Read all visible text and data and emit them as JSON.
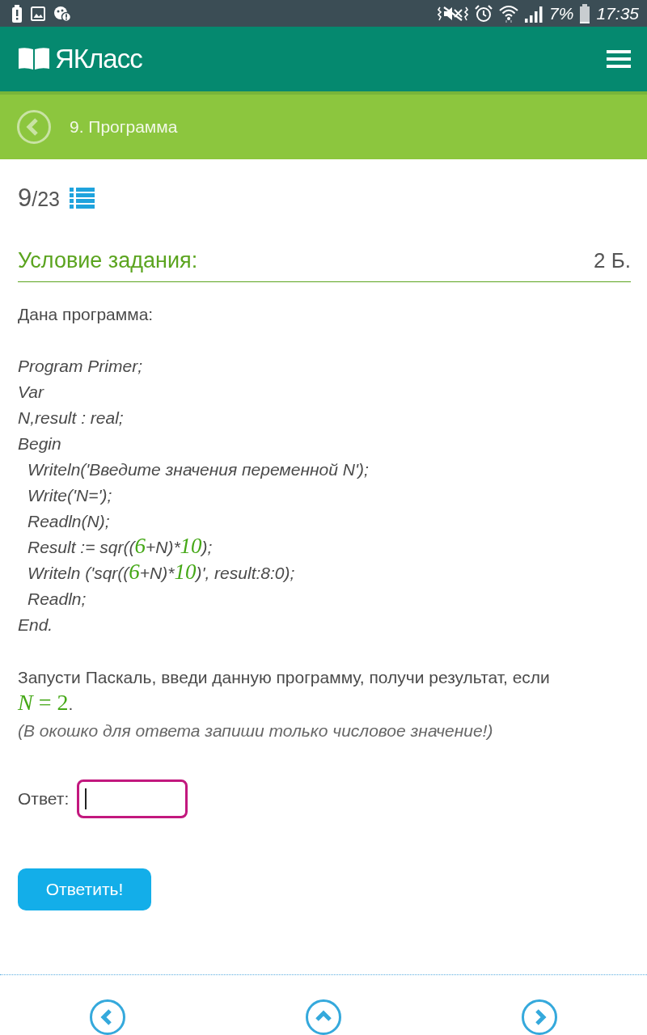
{
  "status_bar": {
    "battery": "7%",
    "time": "17:35"
  },
  "header": {
    "logo": "ЯКласс"
  },
  "topic_bar": {
    "title": "9. Программа"
  },
  "progress": {
    "current": "9",
    "total": "/23"
  },
  "task": {
    "heading": "Условие задания:",
    "points": "2 Б.",
    "intro": "Дана программа:",
    "code": [
      {
        "parts": [
          {
            "kind": "code",
            "text": "Program Primer;"
          }
        ]
      },
      {
        "parts": [
          {
            "kind": "code",
            "text": "Var"
          }
        ]
      },
      {
        "parts": [
          {
            "kind": "code",
            "text": "N,result : real;"
          }
        ]
      },
      {
        "parts": [
          {
            "kind": "code",
            "text": "Begin"
          }
        ],
        "children": [
          {
            "parts": [
              {
                "kind": "code",
                "text": "Writeln('Введите значения переменной N');"
              }
            ]
          },
          {
            "parts": [
              {
                "kind": "code",
                "text": "Write('N=');"
              }
            ]
          },
          {
            "parts": [
              {
                "kind": "code",
                "text": "Readln(N);"
              }
            ]
          },
          {
            "parts": [
              {
                "kind": "code",
                "text": "Result := sqr(("
              },
              {
                "kind": "number",
                "text": "6"
              },
              {
                "kind": "code",
                "text": "+N)*"
              },
              {
                "kind": "number",
                "text": "10"
              },
              {
                "kind": "code",
                "text": ");"
              }
            ]
          },
          {
            "parts": [
              {
                "kind": "code",
                "text": "Writeln ('sqr(("
              },
              {
                "kind": "number",
                "text": "6"
              },
              {
                "kind": "code",
                "text": "+N)*"
              },
              {
                "kind": "number",
                "text": "10"
              },
              {
                "kind": "code",
                "text": ")', result:8:0);"
              }
            ]
          },
          {
            "parts": [
              {
                "kind": "code",
                "text": "Readln;"
              }
            ]
          }
        ]
      },
      {
        "parts": [
          {
            "kind": "code",
            "text": "End."
          }
        ]
      }
    ],
    "question": [
      {
        "kind": "text",
        "text": "Запусти Паскаль, введи данную программу, получи результат, если "
      },
      {
        "kind": "math",
        "text": "*N* = 2"
      },
      {
        "kind": "text",
        "text": "."
      }
    ],
    "note": "(В окошко для ответа запиши только числовое значение!)"
  },
  "answer": {
    "label": "Ответ:",
    "focused": true
  },
  "submit_button": "Ответить!",
  "bottom_nav": [
    {
      "kind": "previous"
    },
    {
      "kind": "up"
    },
    {
      "kind": "next"
    }
  ]
}
